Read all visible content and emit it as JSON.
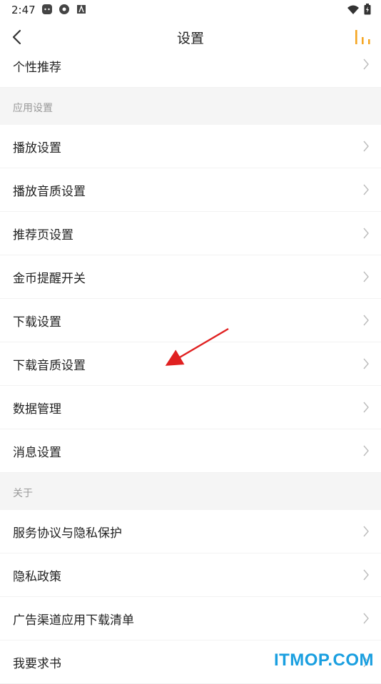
{
  "status_bar": {
    "time": "2:47",
    "left_icons": [
      "android-icon",
      "settings-sync-icon",
      "font-icon"
    ],
    "right_icons": [
      "wifi-icon",
      "battery-icon"
    ]
  },
  "header": {
    "title": "设置",
    "back_icon": "back-icon",
    "right_icon": "equalizer-icon",
    "accent_color": "#f5a623"
  },
  "top_item": {
    "label": "个性推荐"
  },
  "sections": [
    {
      "header": "应用设置",
      "items": [
        {
          "label": "播放设置"
        },
        {
          "label": "播放音质设置"
        },
        {
          "label": "推荐页设置"
        },
        {
          "label": "金币提醒开关"
        },
        {
          "label": "下载设置"
        },
        {
          "label": "下载音质设置"
        },
        {
          "label": "数据管理"
        },
        {
          "label": "消息设置"
        }
      ]
    },
    {
      "header": "关于",
      "items": [
        {
          "label": "服务协议与隐私保护"
        },
        {
          "label": "隐私政策"
        },
        {
          "label": "广告渠道应用下载清单"
        },
        {
          "label": "我要求书"
        }
      ]
    }
  ],
  "annotation": {
    "color": "#e02020"
  },
  "watermark": "ITMOP.COM"
}
